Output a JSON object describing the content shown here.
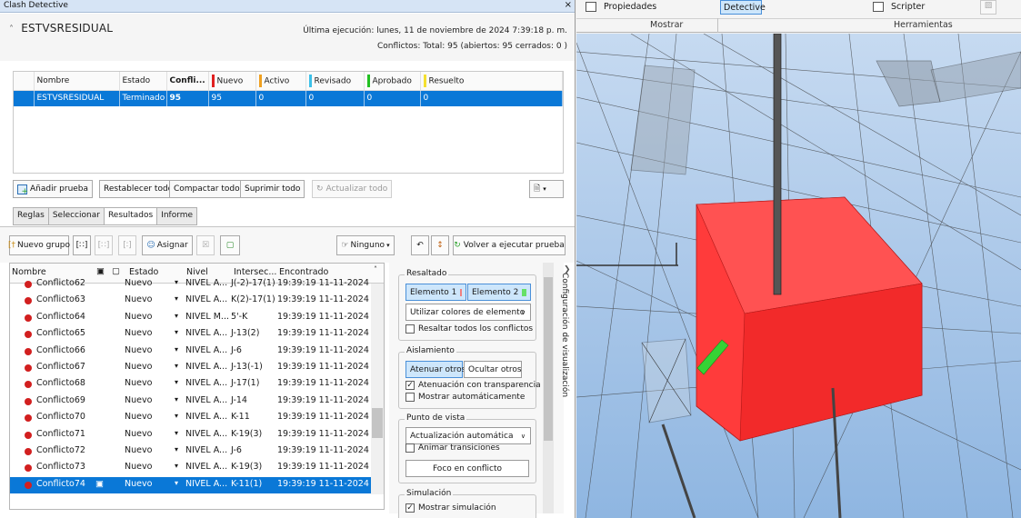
{
  "window": {
    "title": "Clash Detective",
    "close": "×"
  },
  "test": {
    "name": "ESTVSRESIDUAL",
    "last_run": "Última ejecución:  lunes, 11 de noviembre de 2024 7:39:18 p. m.",
    "conflicts_summary": "Conflictos:  Total:  95  (abiertos:  95  cerrados:  0 )"
  },
  "test_table": {
    "headers": {
      "name": "Nombre",
      "status": "Estado",
      "conflicts": "Confli...",
      "new": "Nuevo",
      "active": "Activo",
      "reviewed": "Revisado",
      "approved": "Aprobado",
      "resolved": "Resuelto"
    },
    "colors": {
      "new": "#e02020",
      "active": "#f0a020",
      "reviewed": "#3cc0e8",
      "approved": "#22c022",
      "resolved": "#f4e030"
    },
    "row": {
      "name": "ESTVSRESIDUAL",
      "status": "Terminado",
      "conflicts": "95",
      "new": "95",
      "active": "0",
      "reviewed": "0",
      "approved": "0",
      "resolved": "0"
    }
  },
  "test_buttons": {
    "add": "Añadir prueba",
    "reset_all": "Restablecer todo",
    "compact_all": "Compactar todo",
    "delete_all": "Suprimir todo",
    "update_all": "Actualizar todo"
  },
  "tabs": [
    "Reglas",
    "Seleccionar",
    "Resultados",
    "Informe"
  ],
  "results_toolbar": {
    "new_group": "Nuevo grupo",
    "assign": "Asignar",
    "none": "Ninguno",
    "rerun": "Volver a ejecutar prueba"
  },
  "list_headers": {
    "name": "Nombre",
    "status": "Estado",
    "level": "Nivel",
    "intersection": "Intersec...",
    "found": "Encontrado"
  },
  "conflicts": [
    {
      "name": "Conflicto62",
      "status": "Nuevo",
      "level": "NIVEL A...",
      "grid": "J(-2)-17(1)",
      "found": "19:39:19 11-11-2024"
    },
    {
      "name": "Conflicto63",
      "status": "Nuevo",
      "level": "NIVEL A...",
      "grid": "K(2)-17(1)",
      "found": "19:39:19 11-11-2024"
    },
    {
      "name": "Conflicto64",
      "status": "Nuevo",
      "level": "NIVEL M...",
      "grid": "5'-K",
      "found": "19:39:19 11-11-2024"
    },
    {
      "name": "Conflicto65",
      "status": "Nuevo",
      "level": "NIVEL A...",
      "grid": "J-13(2)",
      "found": "19:39:19 11-11-2024"
    },
    {
      "name": "Conflicto66",
      "status": "Nuevo",
      "level": "NIVEL A...",
      "grid": "J-6",
      "found": "19:39:19 11-11-2024"
    },
    {
      "name": "Conflicto67",
      "status": "Nuevo",
      "level": "NIVEL A...",
      "grid": "J-13(-1)",
      "found": "19:39:19 11-11-2024"
    },
    {
      "name": "Conflicto68",
      "status": "Nuevo",
      "level": "NIVEL A...",
      "grid": "J-17(1)",
      "found": "19:39:19 11-11-2024"
    },
    {
      "name": "Conflicto69",
      "status": "Nuevo",
      "level": "NIVEL A...",
      "grid": "J-14",
      "found": "19:39:19 11-11-2024"
    },
    {
      "name": "Conflicto70",
      "status": "Nuevo",
      "level": "NIVEL A...",
      "grid": "K-11",
      "found": "19:39:19 11-11-2024"
    },
    {
      "name": "Conflicto71",
      "status": "Nuevo",
      "level": "NIVEL A...",
      "grid": "K-19(3)",
      "found": "19:39:19 11-11-2024"
    },
    {
      "name": "Conflicto72",
      "status": "Nuevo",
      "level": "NIVEL A...",
      "grid": "J-6",
      "found": "19:39:19 11-11-2024"
    },
    {
      "name": "Conflicto73",
      "status": "Nuevo",
      "level": "NIVEL A...",
      "grid": "K-19(3)",
      "found": "19:39:19 11-11-2024"
    },
    {
      "name": "Conflicto74",
      "status": "Nuevo",
      "level": "NIVEL A...",
      "grid": "K-11(1)",
      "found": "19:39:19 11-11-2024"
    }
  ],
  "display": {
    "side_label": "Configuración de visualización",
    "highlight": {
      "legend": "Resaltado",
      "item1": "Elemento 1",
      "item2": "Elemento 2",
      "item1_color": "#f08080",
      "item2_color": "#66e066",
      "mode": "Utilizar colores de elemento",
      "all": "Resaltar todos los conflictos"
    },
    "isolation": {
      "legend": "Aislamiento",
      "dim": "Atenuar otros",
      "hide": "Ocultar otros",
      "transparency": "Atenuación con transparencia",
      "auto": "Mostrar automáticamente"
    },
    "viewpoint": {
      "legend": "Punto de vista",
      "mode": "Actualización automática",
      "animate": "Animar transiciones",
      "focus": "Foco en conflicto"
    },
    "simulation": {
      "legend": "Simulación",
      "show": "Mostrar simulación"
    }
  },
  "ribbon": {
    "properties": "Propiedades",
    "detective": "Detective",
    "scripter": "Scripter",
    "show": "Mostrar",
    "tools": "Herramientas"
  }
}
